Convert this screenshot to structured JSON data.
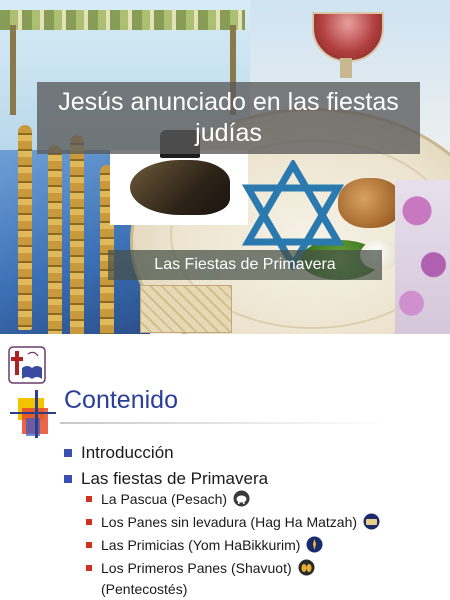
{
  "slide1": {
    "title": "Jesús anunciado en las fiestas judías",
    "subtitle": "Las Fiestas de Primavera"
  },
  "slide2": {
    "heading": "Contenido",
    "items": [
      {
        "label": "Introducción"
      },
      {
        "label": "Las fiestas de Primavera"
      }
    ],
    "subitems": [
      {
        "label": "La Pascua (Pesach)",
        "icon": "lamb-icon",
        "icon_color": "#3a3a3a"
      },
      {
        "label": "Los Panes sin levadura (Hag Ha Matzah)",
        "icon": "bread-icon",
        "icon_color": "#1a2a6a"
      },
      {
        "label": "Las Primicias (Yom HaBikkurim)",
        "icon": "sheaf-icon",
        "icon_color": "#1a2a6a"
      },
      {
        "label": "Los Primeros Panes (Shavuot)",
        "label_line2": "(Pentecostés)",
        "icon": "loaves-icon",
        "icon_color": "#2a2a2a"
      }
    ]
  },
  "colors": {
    "heading": "#2a3e9a",
    "bullet_primary": "#3a50b0",
    "bullet_secondary": "#d03020"
  }
}
